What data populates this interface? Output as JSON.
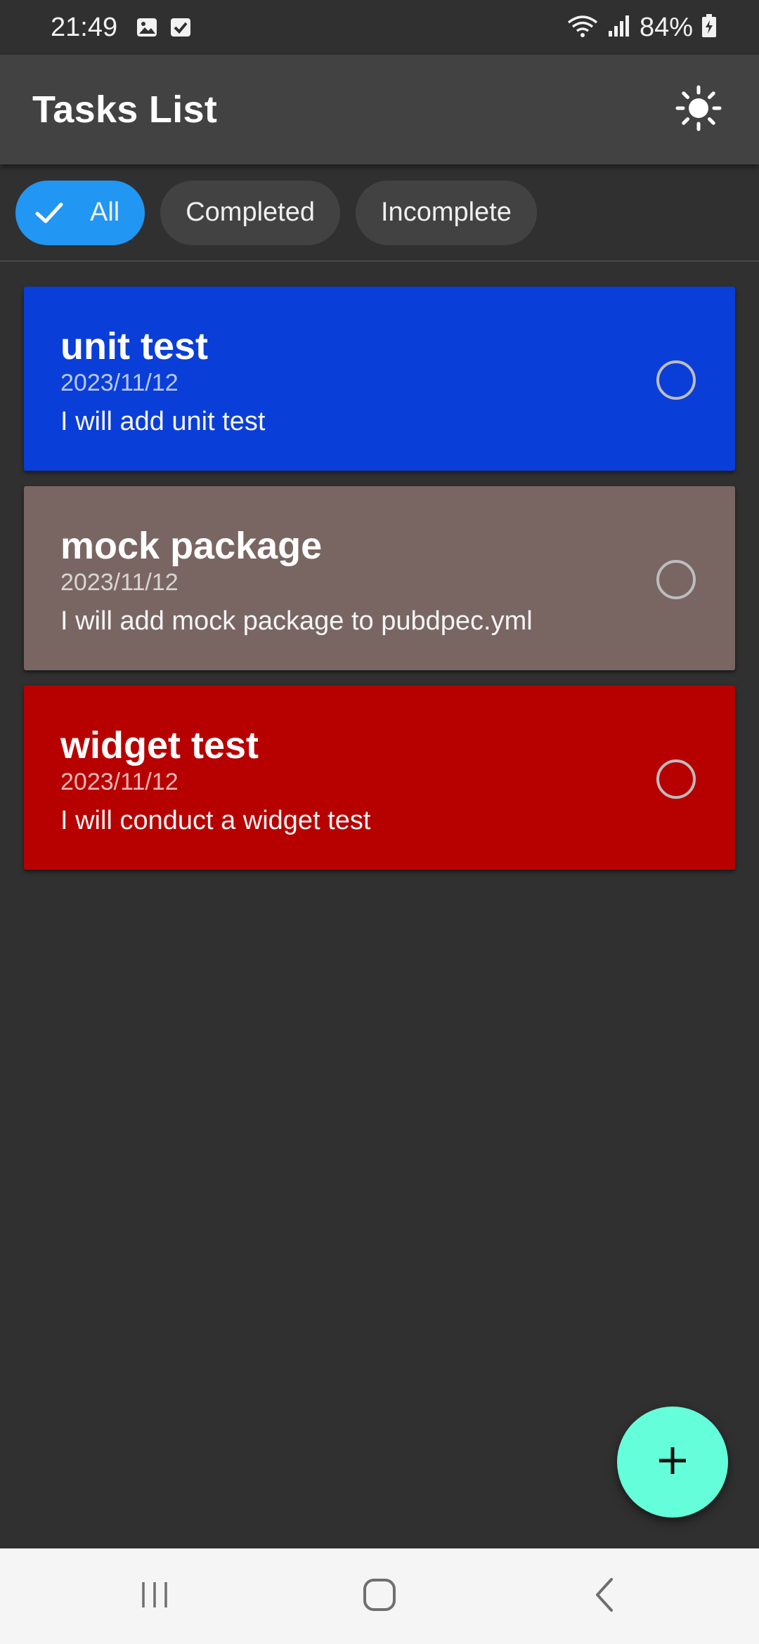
{
  "status_bar": {
    "time": "21:49",
    "battery": "84%",
    "icons": [
      "image-icon",
      "checkbox-icon",
      "wifi-icon",
      "signal-icon",
      "battery-icon"
    ]
  },
  "app_bar": {
    "title": "Tasks List",
    "theme_icon": "sun-icon"
  },
  "filters": [
    {
      "label": "All",
      "selected": true
    },
    {
      "label": "Completed",
      "selected": false
    },
    {
      "label": "Incomplete",
      "selected": false
    }
  ],
  "tasks": [
    {
      "title": "unit test",
      "date": "2023/11/12",
      "description": "I will add unit test",
      "color": "#0a3ed8",
      "completed": false
    },
    {
      "title": "mock package",
      "date": "2023/11/12",
      "description": "I will add mock package to pubdpec.yml",
      "color": "#796663",
      "completed": false
    },
    {
      "title": "widget test",
      "date": "2023/11/12",
      "description": "I will conduct a widget test",
      "color": "#b70000",
      "completed": false
    }
  ],
  "fab": {
    "icon": "plus-icon",
    "color": "#64ffda"
  },
  "nav_bar": {
    "buttons": [
      "recents-icon",
      "home-icon",
      "back-icon"
    ]
  },
  "colors": {
    "background": "#303030",
    "app_bar": "#424242",
    "chip_selected": "#2196f3",
    "chip": "#424242"
  }
}
